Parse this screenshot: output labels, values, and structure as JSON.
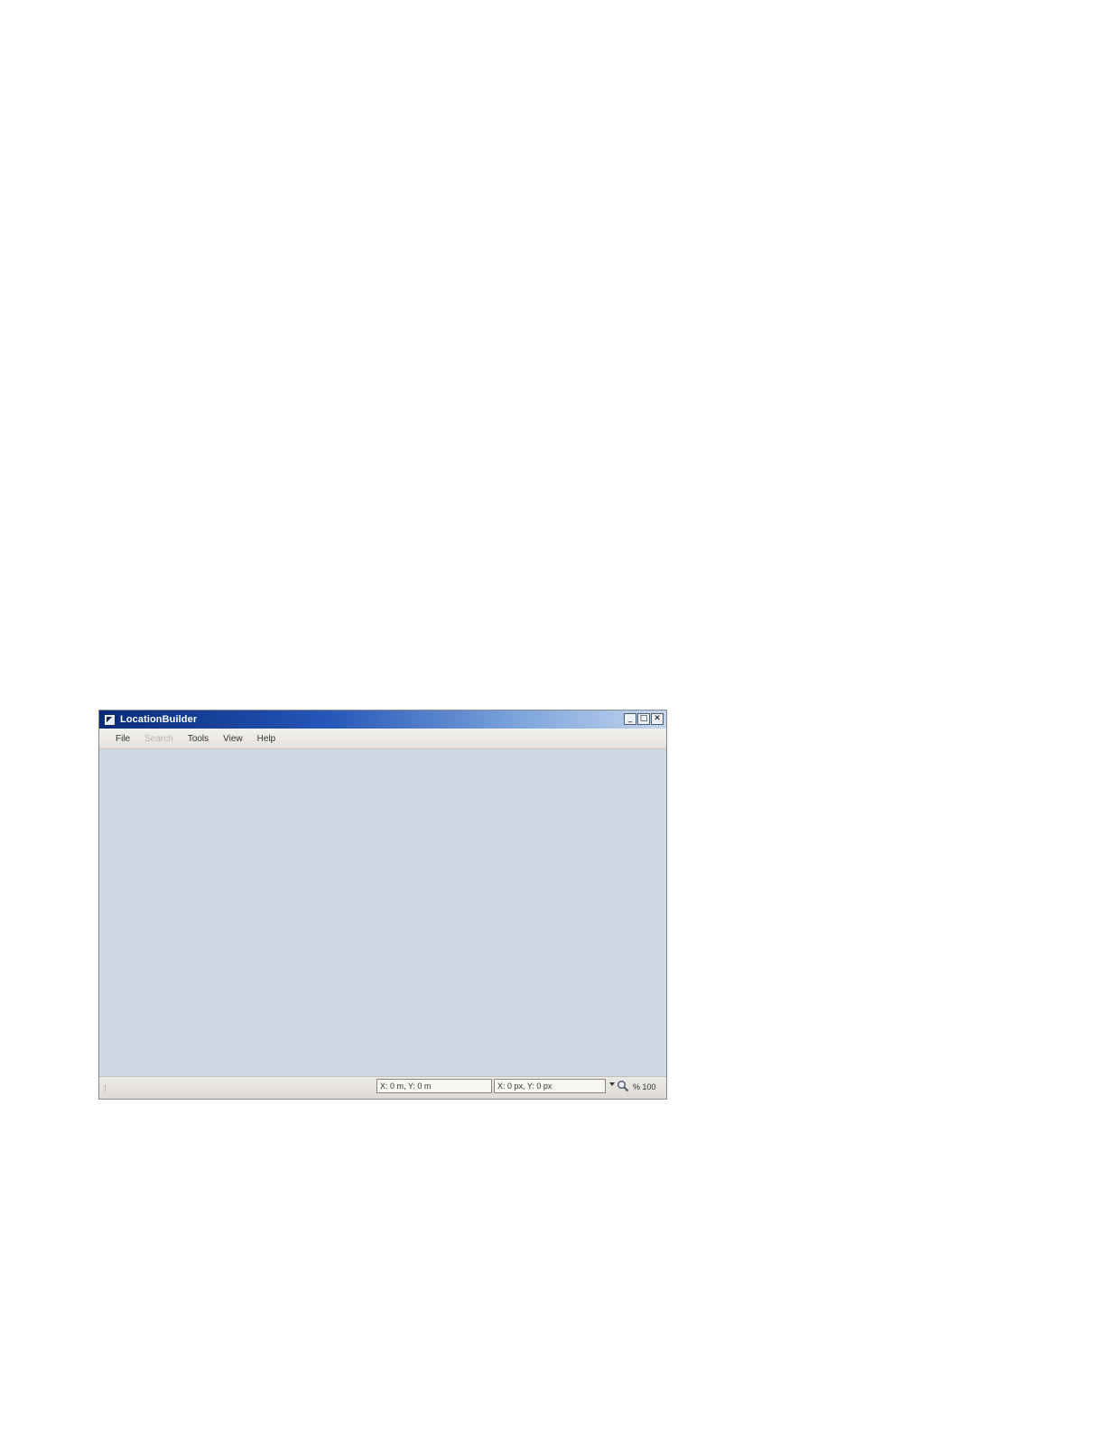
{
  "window": {
    "title": "LocationBuilder",
    "controls": {
      "minimize": "_",
      "maximize": "□",
      "close": "✕"
    }
  },
  "menu": {
    "items": [
      {
        "label": "File",
        "enabled": true
      },
      {
        "label": "Search",
        "enabled": false
      },
      {
        "label": "Tools",
        "enabled": true
      },
      {
        "label": "View",
        "enabled": true
      },
      {
        "label": "Help",
        "enabled": true
      }
    ]
  },
  "status": {
    "meters_readout": "X: 0 m, Y: 0 m",
    "pixels_readout": "X: 0 px, Y: 0 px",
    "zoom_text": "% 100"
  },
  "colors": {
    "canvas_background": "#cdd8e3",
    "titlebar_start": "#0a2b7a",
    "titlebar_end": "#c3d6ee"
  },
  "icons": {
    "app": "app-icon",
    "zoom": "magnifier-icon",
    "dropdown": "chevron-down-icon"
  }
}
